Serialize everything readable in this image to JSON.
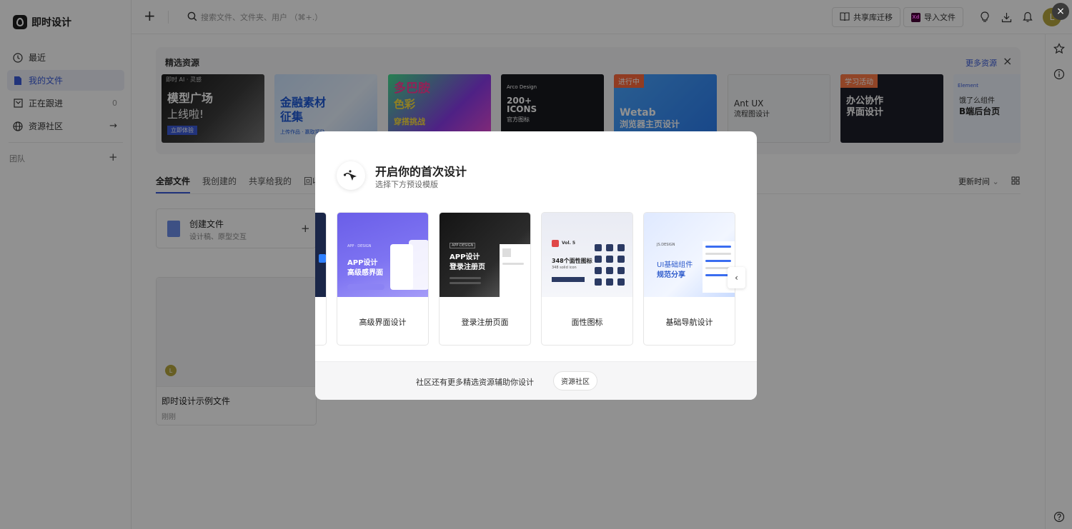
{
  "app": {
    "name": "即时设计"
  },
  "sidebar": {
    "items": [
      {
        "label": "最近",
        "icon": "clock-icon"
      },
      {
        "label": "我的文件",
        "icon": "file-icon",
        "active": true
      },
      {
        "label": "正在跟进",
        "icon": "bookmark-icon",
        "count": "0"
      },
      {
        "label": "资源社区",
        "icon": "globe-icon",
        "trail": "→"
      }
    ],
    "team_label": "团队",
    "team_add": "+"
  },
  "topbar": {
    "new_label": "+",
    "search_placeholder": "搜索文件、文件夹、用户 （⌘+.）",
    "share_lib_label": "共享库迁移",
    "import_label": "导入文件",
    "xd_badge": "Xd",
    "avatar_letter": "L"
  },
  "featured": {
    "title": "精选资源",
    "more_label": "更多资源",
    "close_label": "×",
    "cards": [
      {
        "title": "模型广场",
        "title2": "上线啦!",
        "sub": "立即体验",
        "tag": "即时 AI · 灵感"
      },
      {
        "title": "金融素材",
        "title2": "征集",
        "sub": "上传作品 · 赢取奖励",
        "tag": ""
      },
      {
        "title": "多巴胺",
        "title2": "色彩",
        "sub": "穿搭挑战",
        "tag": ""
      },
      {
        "title": "200+",
        "title2": "ICONS",
        "sub": "官方图标",
        "tag": "Arco Design"
      },
      {
        "title": "Wetab",
        "title2": "浏览器主页设计",
        "sub": "",
        "tag": "进行中"
      },
      {
        "title": "Ant UX",
        "title2": "流程图设计",
        "sub": "",
        "tag": ""
      },
      {
        "title": "办公协作",
        "title2": "界面设计",
        "sub": "",
        "tag": "学习活动"
      },
      {
        "title": "饿了么组件",
        "title2": "B端后台页",
        "sub": "",
        "tag": "Element"
      }
    ]
  },
  "tabs": [
    {
      "label": "全部文件",
      "active": true
    },
    {
      "label": "我创建的"
    },
    {
      "label": "共享给我的"
    },
    {
      "label": "回收站"
    }
  ],
  "sort_label": "更新时间",
  "create_card": {
    "title": "创建文件",
    "subtitle": "设计稿、原型交互",
    "plus": "+"
  },
  "file_card": {
    "name": "即时设计示例文件",
    "time": "刚刚",
    "avatar_letter": "L"
  },
  "modal": {
    "title": "开启你的首次设计",
    "subtitle": "选择下方预设模版",
    "templates": [
      {
        "label": "高级界面设计",
        "thumb_title": "APP设计",
        "thumb_title2": "高级感界面",
        "thumb_tag": "APP · DESIGN"
      },
      {
        "label": "登录注册页面",
        "thumb_title": "APP设计",
        "thumb_title2": "登录注册页",
        "thumb_tag": "APP·DESIGN"
      },
      {
        "label": "面性图标",
        "thumb_title": "348个面性图标",
        "thumb_title2": "348 solid icon",
        "thumb_tag": "Vol. 5"
      },
      {
        "label": "基础导航设计",
        "thumb_title": "UI基础组件",
        "thumb_title2": "规范分享",
        "thumb_tag": "JS.DESIGN"
      }
    ],
    "prev_label": "‹",
    "footer_text": "社区还有更多精选资源辅助你设计",
    "footer_button": "资源社区",
    "close_label": "×"
  },
  "colors": {
    "accent": "#3a5bd9",
    "overlay": "rgba(0,0,0,0.43)"
  }
}
